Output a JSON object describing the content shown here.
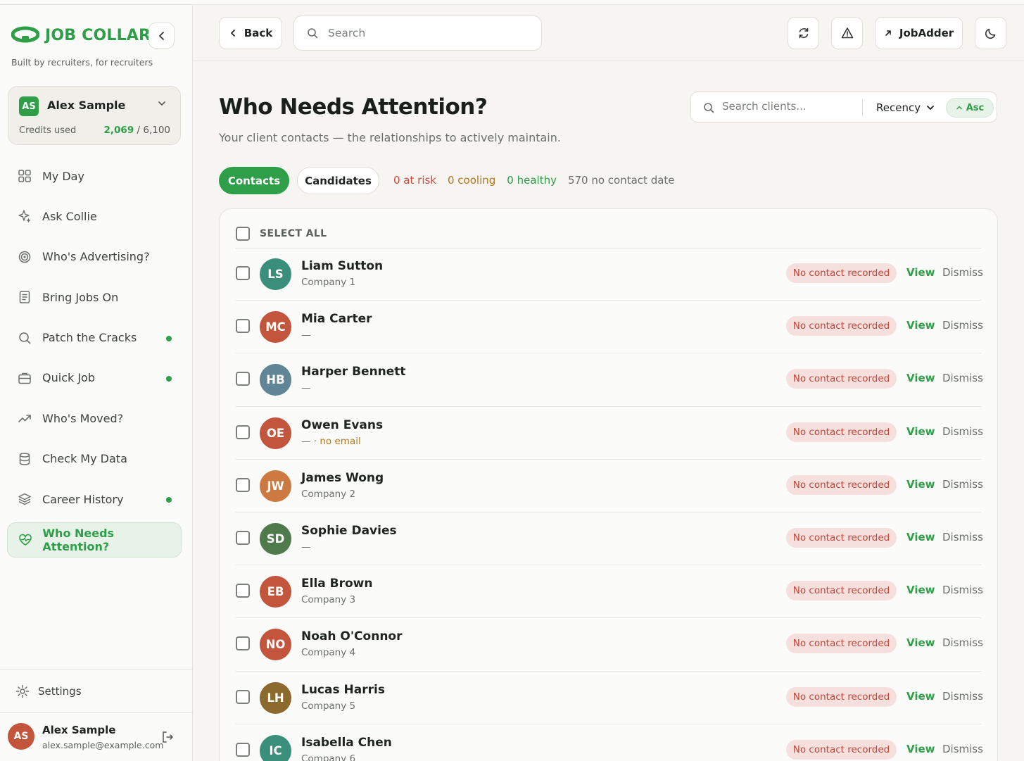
{
  "brand": {
    "name": "JOB COLLAR",
    "tagline": "Built by recruiters, for recruiters"
  },
  "user_card": {
    "initials": "AS",
    "name": "Alex Sample",
    "credits_label": "Credits used",
    "credits_used": "2,069",
    "credits_total": " / 6,100"
  },
  "nav": [
    {
      "label": "My Day",
      "icon": "grid-icon",
      "dot": false,
      "active": false
    },
    {
      "label": "Ask Collie",
      "icon": "sparkle-icon",
      "dot": false,
      "active": false
    },
    {
      "label": "Who's Advertising?",
      "icon": "target-icon",
      "dot": false,
      "active": false
    },
    {
      "label": "Bring Jobs On",
      "icon": "document-icon",
      "dot": false,
      "active": false
    },
    {
      "label": "Patch the Cracks",
      "icon": "search-icon",
      "dot": true,
      "active": false
    },
    {
      "label": "Quick Job",
      "icon": "briefcase-icon",
      "dot": true,
      "active": false
    },
    {
      "label": "Who's Moved?",
      "icon": "trend-icon",
      "dot": false,
      "active": false
    },
    {
      "label": "Check My Data",
      "icon": "database-icon",
      "dot": false,
      "active": false
    },
    {
      "label": "Career History",
      "icon": "layers-icon",
      "dot": true,
      "active": false
    },
    {
      "label": "Who Needs Attention?",
      "icon": "heart-pulse-icon",
      "dot": false,
      "active": true
    }
  ],
  "settings": {
    "label": "Settings"
  },
  "profile": {
    "initials": "AS",
    "name": "Alex Sample",
    "email": "alex.sample@example.com"
  },
  "topbar": {
    "back_label": "Back",
    "search_placeholder": "Search",
    "jobadder_label": "JobAdder"
  },
  "page": {
    "title": "Who Needs Attention?",
    "subtitle": "Your client contacts — the relationships to actively maintain."
  },
  "filter": {
    "search_placeholder": "Search clients...",
    "sort_label": "Recency",
    "order_label": "Asc"
  },
  "tabs": {
    "contacts": "Contacts",
    "candidates": "Candidates"
  },
  "stats": {
    "at_risk": "0 at risk",
    "cooling": "0 cooling",
    "healthy": "0 healthy",
    "no_contact": "570 no contact date"
  },
  "list": {
    "select_all": "SELECT ALL",
    "badge_label": "No contact recorded",
    "view_label": "View",
    "dismiss_label": "Dismiss",
    "rows": [
      {
        "initials": "LS",
        "name": "Liam Sutton",
        "company": "Company 1",
        "warn": "",
        "color": "#3a8f7a"
      },
      {
        "initials": "MC",
        "name": "Mia Carter",
        "company": "—",
        "warn": "",
        "color": "#c2553b"
      },
      {
        "initials": "HB",
        "name": "Harper Bennett",
        "company": "—",
        "warn": "",
        "color": "#5f8597"
      },
      {
        "initials": "OE",
        "name": "Owen Evans",
        "company": "— · ",
        "warn": "no email",
        "color": "#c2553b"
      },
      {
        "initials": "JW",
        "name": "James Wong",
        "company": "Company 2",
        "warn": "",
        "color": "#cd7a42"
      },
      {
        "initials": "SD",
        "name": "Sophie Davies",
        "company": "—",
        "warn": "",
        "color": "#4e7a4c"
      },
      {
        "initials": "EB",
        "name": "Ella Brown",
        "company": "Company 3",
        "warn": "",
        "color": "#c2553b"
      },
      {
        "initials": "NO",
        "name": "Noah O'Connor",
        "company": "Company 4",
        "warn": "",
        "color": "#c2553b"
      },
      {
        "initials": "LH",
        "name": "Lucas Harris",
        "company": "Company 5",
        "warn": "",
        "color": "#8c6a2e"
      },
      {
        "initials": "IC",
        "name": "Isabella Chen",
        "company": "Company 6",
        "warn": "",
        "color": "#3a8f7a"
      }
    ]
  },
  "colors": {
    "brand": "#2e9e48",
    "risk": "#d2463a",
    "cooling": "#b8751b"
  }
}
